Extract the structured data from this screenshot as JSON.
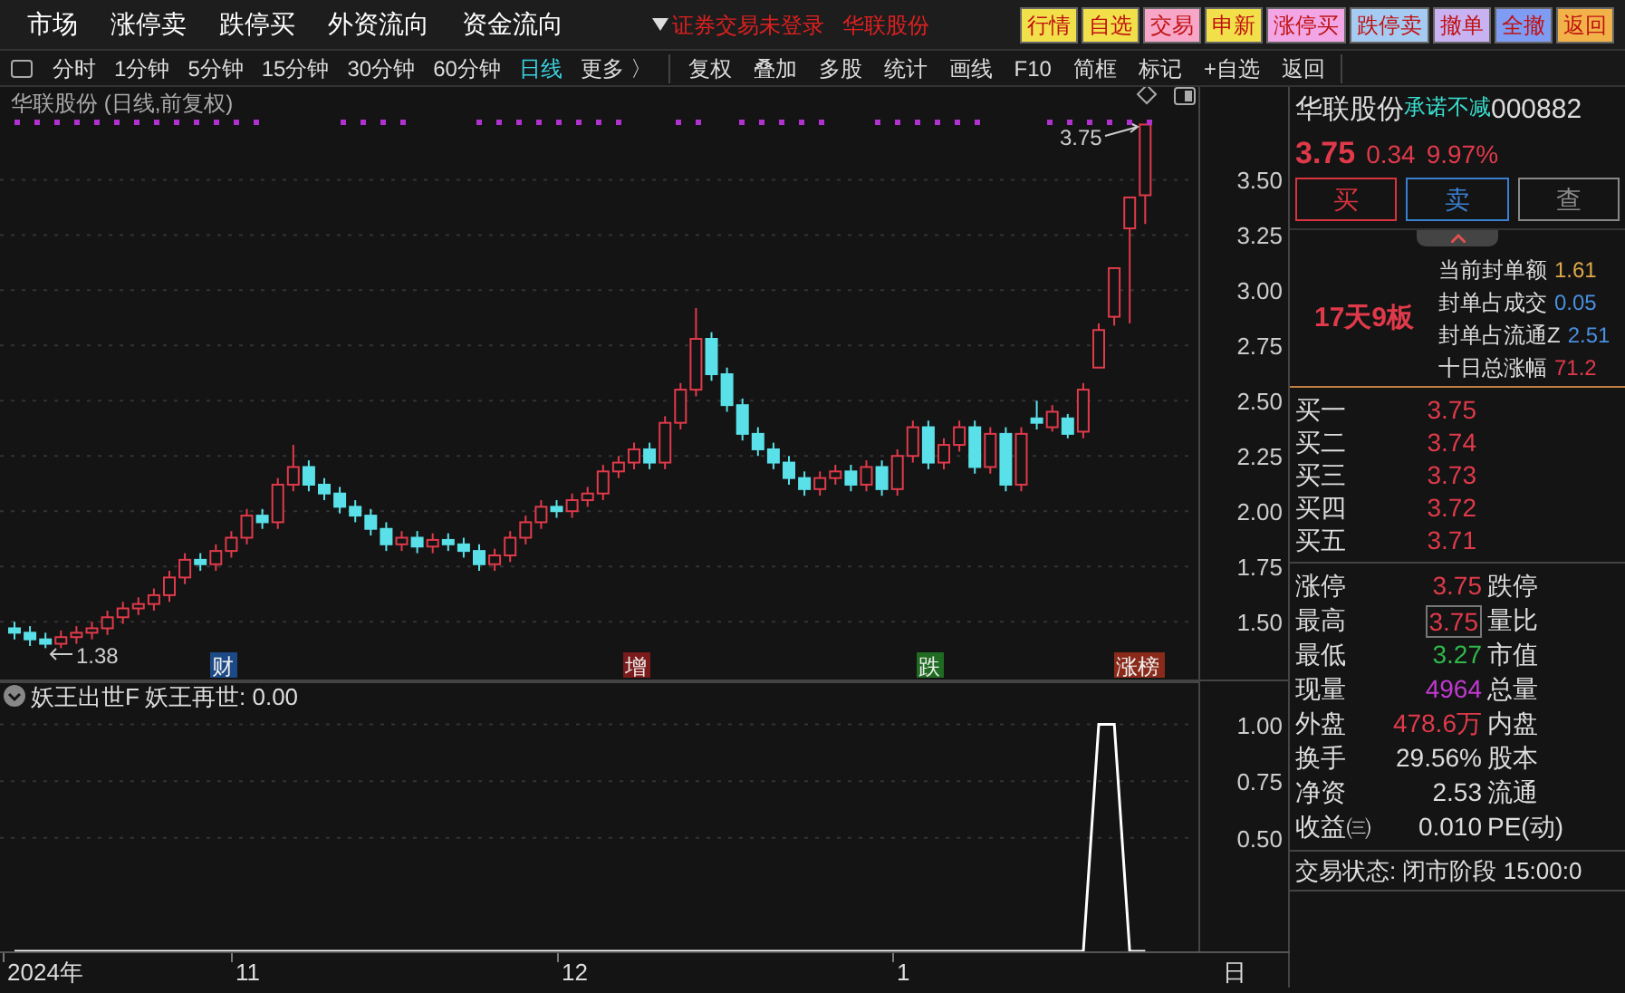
{
  "menu": [
    "市场",
    "涨停卖",
    "跌停买",
    "外资流向",
    "资金流向"
  ],
  "login_notice": "证券交易未登录",
  "notice_stock": "华联股份",
  "action_buttons": [
    {
      "label": "行情",
      "color": "#f2e04a"
    },
    {
      "label": "自选",
      "color": "#f2e04a"
    },
    {
      "label": "交易",
      "color": "#f7a6c8"
    },
    {
      "label": "申新",
      "color": "#f2e04a"
    },
    {
      "label": "涨停买",
      "color": "#f2a6e6"
    },
    {
      "label": "跌停卖",
      "color": "#a6cbf2"
    },
    {
      "label": "撤单",
      "color": "#c9b2f2"
    },
    {
      "label": "全撤",
      "color": "#7f9cf5"
    },
    {
      "label": "返回",
      "color": "#f2b24a"
    }
  ],
  "period_tabs": [
    {
      "label": "分时",
      "selected": false
    },
    {
      "label": "1分钟",
      "selected": false
    },
    {
      "label": "5分钟",
      "selected": false
    },
    {
      "label": "15分钟",
      "selected": false
    },
    {
      "label": "30分钟",
      "selected": false
    },
    {
      "label": "60分钟",
      "selected": false
    },
    {
      "label": "日线",
      "selected": true
    },
    {
      "label": "更多 〉",
      "selected": false
    }
  ],
  "tools": [
    "复权",
    "叠加",
    "多股",
    "统计",
    "画线",
    "F10",
    "简框",
    "标记",
    "+自选",
    "返回"
  ],
  "chart": {
    "title": "华联股份 (日线,前复权)",
    "high_label": "3.75",
    "low_label": "1.38",
    "event_tags": [
      {
        "label": "财",
        "color": "#1c4a86"
      },
      {
        "label": "增",
        "color": "#7a1a1a"
      },
      {
        "label": "跌",
        "color": "#1f6b22"
      },
      {
        "label": "涨榜",
        "color": "#8a2a1a"
      }
    ],
    "chart_data": {
      "type": "candlestick",
      "grid": true,
      "ohlc": [
        [
          1.47,
          1.5,
          1.42,
          1.45
        ],
        [
          1.45,
          1.48,
          1.39,
          1.42
        ],
        [
          1.42,
          1.45,
          1.38,
          1.4
        ],
        [
          1.4,
          1.46,
          1.38,
          1.43
        ],
        [
          1.43,
          1.48,
          1.4,
          1.45
        ],
        [
          1.45,
          1.5,
          1.42,
          1.47
        ],
        [
          1.47,
          1.55,
          1.44,
          1.52
        ],
        [
          1.52,
          1.59,
          1.49,
          1.56
        ],
        [
          1.56,
          1.61,
          1.53,
          1.58
        ],
        [
          1.58,
          1.65,
          1.55,
          1.62
        ],
        [
          1.62,
          1.73,
          1.59,
          1.7
        ],
        [
          1.7,
          1.81,
          1.67,
          1.78
        ],
        [
          1.78,
          1.81,
          1.73,
          1.76
        ],
        [
          1.76,
          1.85,
          1.73,
          1.82
        ],
        [
          1.82,
          1.91,
          1.79,
          1.88
        ],
        [
          1.88,
          2.01,
          1.85,
          1.98
        ],
        [
          1.98,
          2.01,
          1.92,
          1.95
        ],
        [
          1.95,
          2.15,
          1.92,
          2.12
        ],
        [
          2.12,
          2.3,
          2.09,
          2.2
        ],
        [
          2.2,
          2.23,
          2.09,
          2.12
        ],
        [
          2.12,
          2.15,
          2.05,
          2.08
        ],
        [
          2.08,
          2.11,
          1.99,
          2.02
        ],
        [
          2.02,
          2.05,
          1.95,
          1.98
        ],
        [
          1.98,
          2.01,
          1.89,
          1.92
        ],
        [
          1.92,
          1.95,
          1.82,
          1.85
        ],
        [
          1.85,
          1.91,
          1.82,
          1.88
        ],
        [
          1.88,
          1.91,
          1.81,
          1.84
        ],
        [
          1.84,
          1.9,
          1.81,
          1.87
        ],
        [
          1.87,
          1.9,
          1.82,
          1.85
        ],
        [
          1.85,
          1.88,
          1.79,
          1.82
        ],
        [
          1.82,
          1.85,
          1.73,
          1.76
        ],
        [
          1.76,
          1.83,
          1.73,
          1.8
        ],
        [
          1.8,
          1.91,
          1.77,
          1.88
        ],
        [
          1.88,
          1.98,
          1.85,
          1.95
        ],
        [
          1.95,
          2.05,
          1.92,
          2.02
        ],
        [
          2.02,
          2.05,
          1.97,
          2.0
        ],
        [
          2.0,
          2.08,
          1.97,
          2.05
        ],
        [
          2.05,
          2.11,
          2.02,
          2.08
        ],
        [
          2.08,
          2.21,
          2.05,
          2.18
        ],
        [
          2.18,
          2.25,
          2.15,
          2.22
        ],
        [
          2.22,
          2.31,
          2.19,
          2.28
        ],
        [
          2.28,
          2.31,
          2.19,
          2.22
        ],
        [
          2.22,
          2.43,
          2.19,
          2.4
        ],
        [
          2.4,
          2.58,
          2.37,
          2.55
        ],
        [
          2.55,
          2.92,
          2.52,
          2.78
        ],
        [
          2.78,
          2.81,
          2.59,
          2.62
        ],
        [
          2.62,
          2.65,
          2.45,
          2.48
        ],
        [
          2.48,
          2.51,
          2.32,
          2.35
        ],
        [
          2.35,
          2.38,
          2.25,
          2.28
        ],
        [
          2.28,
          2.31,
          2.19,
          2.22
        ],
        [
          2.22,
          2.25,
          2.12,
          2.15
        ],
        [
          2.15,
          2.18,
          2.07,
          2.1
        ],
        [
          2.1,
          2.18,
          2.07,
          2.15
        ],
        [
          2.15,
          2.21,
          2.12,
          2.18
        ],
        [
          2.18,
          2.21,
          2.09,
          2.12
        ],
        [
          2.12,
          2.23,
          2.09,
          2.2
        ],
        [
          2.2,
          2.23,
          2.07,
          2.1
        ],
        [
          2.1,
          2.28,
          2.07,
          2.25
        ],
        [
          2.25,
          2.41,
          2.22,
          2.38
        ],
        [
          2.38,
          2.41,
          2.19,
          2.22
        ],
        [
          2.22,
          2.33,
          2.19,
          2.3
        ],
        [
          2.3,
          2.41,
          2.27,
          2.38
        ],
        [
          2.38,
          2.41,
          2.17,
          2.2
        ],
        [
          2.2,
          2.38,
          2.17,
          2.35
        ],
        [
          2.35,
          2.38,
          2.09,
          2.12
        ],
        [
          2.12,
          2.38,
          2.09,
          2.35
        ],
        [
          2.42,
          2.5,
          2.37,
          2.4
        ],
        [
          2.38,
          2.48,
          2.36,
          2.45
        ],
        [
          2.42,
          2.44,
          2.33,
          2.35
        ],
        [
          2.36,
          2.58,
          2.33,
          2.55
        ],
        [
          2.65,
          2.85,
          2.65,
          2.82
        ],
        [
          2.88,
          3.1,
          2.84,
          3.1
        ],
        [
          3.28,
          3.42,
          2.85,
          3.42
        ],
        [
          3.43,
          3.75,
          3.3,
          3.75
        ]
      ],
      "ylim": [
        1.23,
        3.92
      ],
      "yticks": [
        {
          "value": 3.5,
          "label": "3.50"
        },
        {
          "value": 3.25,
          "label": "3.25"
        },
        {
          "value": 3.0,
          "label": "3.00"
        },
        {
          "value": 2.75,
          "label": "2.75"
        },
        {
          "value": 2.5,
          "label": "2.50"
        },
        {
          "value": 2.25,
          "label": "2.25"
        },
        {
          "value": 2.0,
          "label": "2.00"
        },
        {
          "value": 1.75,
          "label": "1.75"
        },
        {
          "value": 1.5,
          "label": "1.50"
        }
      ]
    }
  },
  "indicator": {
    "name": "妖王出世F",
    "reading": "妖王再世: 0.00",
    "chart_data": {
      "type": "line",
      "grid": true,
      "series": [
        {
          "color": "#ffffff",
          "values": [
            0,
            0,
            0,
            0,
            0,
            0,
            0,
            0,
            0,
            0,
            0,
            0,
            0,
            0,
            0,
            0,
            0,
            0,
            0,
            0,
            0,
            0,
            0,
            0,
            0,
            0,
            0,
            0,
            0,
            0,
            0,
            0,
            0,
            0,
            0,
            0,
            0,
            0,
            0,
            0,
            0,
            0,
            0,
            0,
            0,
            0,
            0,
            0,
            0,
            0,
            0,
            0,
            0,
            0,
            0,
            0,
            0,
            0,
            0,
            0,
            0,
            0,
            0,
            0,
            0,
            0,
            0,
            0,
            0,
            0,
            1,
            1,
            0,
            0
          ]
        }
      ],
      "ylim": [
        0,
        1.19
      ],
      "yticks": [
        {
          "value": 1,
          "label": "1.00"
        },
        {
          "value": 0.75,
          "label": "0.75"
        },
        {
          "value": 0.5,
          "label": "0.50"
        }
      ]
    }
  },
  "date_axis": [
    "2024年",
    "11",
    "12",
    "1"
  ],
  "period_label": "日",
  "quote": {
    "name": "华联股份",
    "tag": "承诺不减",
    "code": "000882",
    "price": "3.75",
    "change": "0.34",
    "percent": "9.97%",
    "buttons": [
      {
        "label": "买",
        "color": "#d8333f"
      },
      {
        "label": "卖",
        "color": "#3a7fd0"
      },
      {
        "label": "查",
        "color": "#888888"
      }
    ],
    "streak": "17天9板",
    "seal_stats": [
      {
        "label": "当前封单额",
        "value": "1.61",
        "color": "#e0a84a"
      },
      {
        "label": "封单占成交",
        "value": "0.05",
        "color": "#4a8fe0"
      },
      {
        "label": "封单占流通Z",
        "value": "2.51",
        "color": "#4a8fe0"
      },
      {
        "label": "十日总涨幅",
        "value": "71.2",
        "color": "#e03a4a"
      }
    ],
    "bids": [
      {
        "label": "买一",
        "price": "3.75"
      },
      {
        "label": "买二",
        "price": "3.74"
      },
      {
        "label": "买三",
        "price": "3.73"
      },
      {
        "label": "买四",
        "price": "3.72"
      },
      {
        "label": "买五",
        "price": "3.71"
      }
    ],
    "stats": [
      {
        "label": "涨停",
        "value": "3.75",
        "color": "#e03a4a",
        "boxed": false,
        "label2": "跌停"
      },
      {
        "label": "最高",
        "value": "3.75",
        "color": "#e03a4a",
        "boxed": true,
        "label2": "量比"
      },
      {
        "label": "最低",
        "value": "3.27",
        "color": "#2fb84a",
        "boxed": false,
        "label2": "市值"
      },
      {
        "label": "现量",
        "value": "4964",
        "color": "#c03ad0",
        "boxed": false,
        "label2": "总量"
      },
      {
        "label": "外盘",
        "value": "478.6万",
        "color": "#e03a4a",
        "boxed": false,
        "label2": "内盘"
      },
      {
        "label": "换手",
        "value": "29.56%",
        "color": "#dddddd",
        "boxed": false,
        "label2": "股本"
      },
      {
        "label": "净资",
        "value": "2.53",
        "color": "#dddddd",
        "boxed": false,
        "label2": "流通"
      },
      {
        "label": "收益㈢",
        "value": "0.010",
        "color": "#dddddd",
        "boxed": false,
        "label2": "PE(动)"
      }
    ],
    "status": "交易状态: 闭市阶段 15:00:0"
  }
}
